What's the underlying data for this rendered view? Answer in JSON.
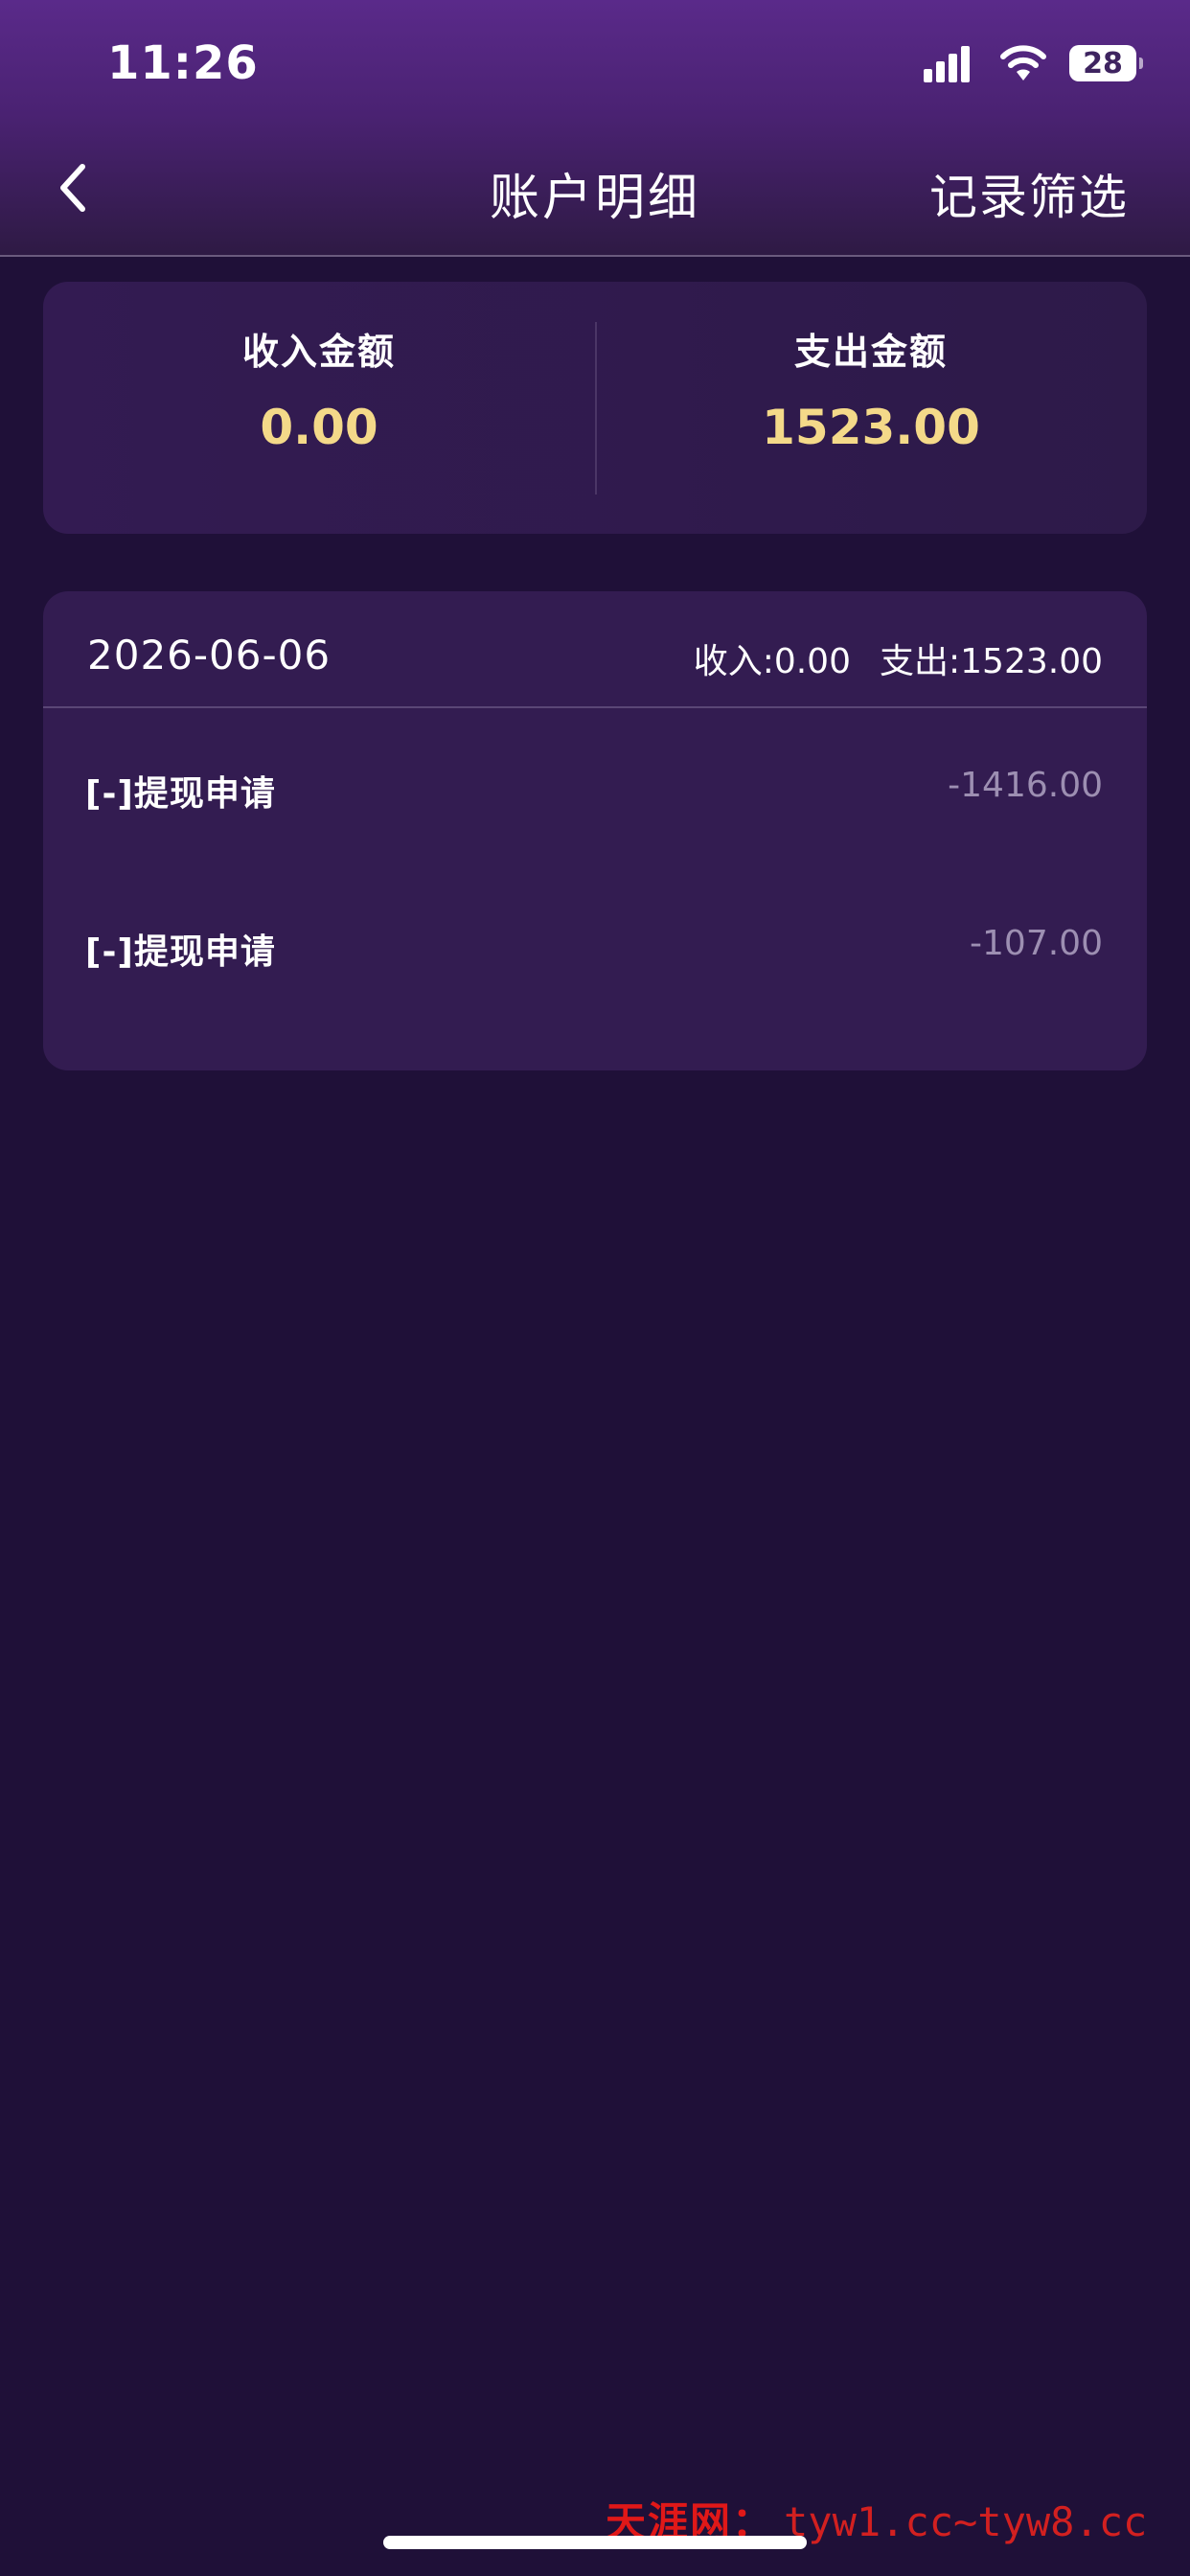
{
  "status_bar": {
    "time": "11:26",
    "battery": "28",
    "icons": [
      "signal-icon",
      "wifi-icon",
      "battery-icon"
    ]
  },
  "nav": {
    "title": "账户明细",
    "filter_label": "记录筛选",
    "back_icon": "chevron-left-icon"
  },
  "summary": {
    "income_label": "收入金额",
    "income_value": "0.00",
    "expense_label": "支出金额",
    "expense_value": "1523.00"
  },
  "records": {
    "date": "2026-06-06",
    "income_summary": "收入:0.00",
    "expense_summary": "支出:1523.00",
    "items": [
      {
        "title": "[-]提现申请",
        "amount": "-1416.00"
      },
      {
        "title": "[-]提现申请",
        "amount": "-107.00"
      }
    ]
  },
  "watermark": {
    "name": "天涯网：",
    "url": "tyw1.cc~tyw8.cc"
  },
  "colors": {
    "background": "#1f1038",
    "card": "#331c51",
    "accent_amount": "#f4d989",
    "muted_amount": "#9d8fb2"
  }
}
